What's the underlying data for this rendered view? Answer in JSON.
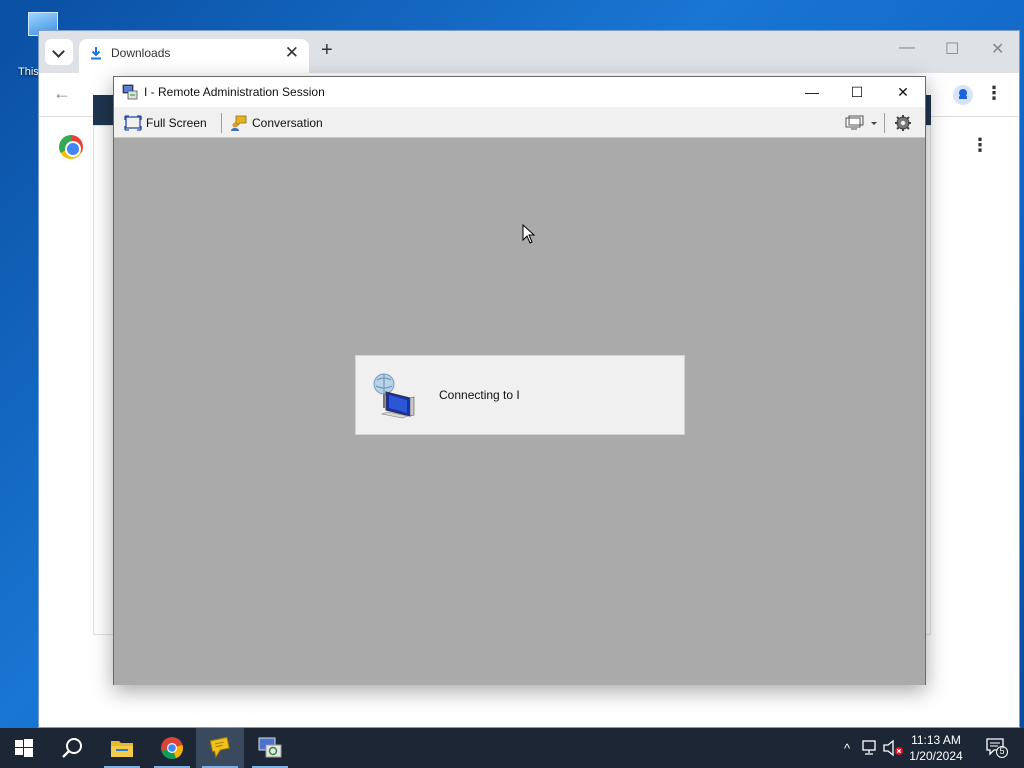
{
  "desktop": {
    "icon_label": "This"
  },
  "browser": {
    "tab_title": "Downloads",
    "close_symbol": "✕",
    "new_tab_symbol": "+",
    "back_symbol": "←",
    "kebab_symbol": "⋮",
    "minimize_symbol": "—",
    "maximize_symbol": "☐",
    "close_window_symbol": "✕"
  },
  "remote_window": {
    "title": "I - Remote Administration Session",
    "toolbar": {
      "full_screen_label": "Full Screen",
      "conversation_label": "Conversation"
    },
    "dialog": {
      "message": "Connecting to I"
    },
    "minimize_symbol": "—",
    "maximize_symbol": "☐",
    "close_symbol": "✕"
  },
  "taskbar": {
    "apps": [
      "start",
      "search",
      "file-explorer",
      "chrome",
      "remote-chat",
      "remote-admin"
    ],
    "clock": {
      "time": "11:13 AM",
      "date": "1/20/2024"
    },
    "notification_count": "5"
  },
  "colors": {
    "desktop_blue": "#1976d2",
    "taskbar": "#1c2634",
    "viewport_gray": "#aaaaaa",
    "chrome_blue": "#1a73e8"
  }
}
